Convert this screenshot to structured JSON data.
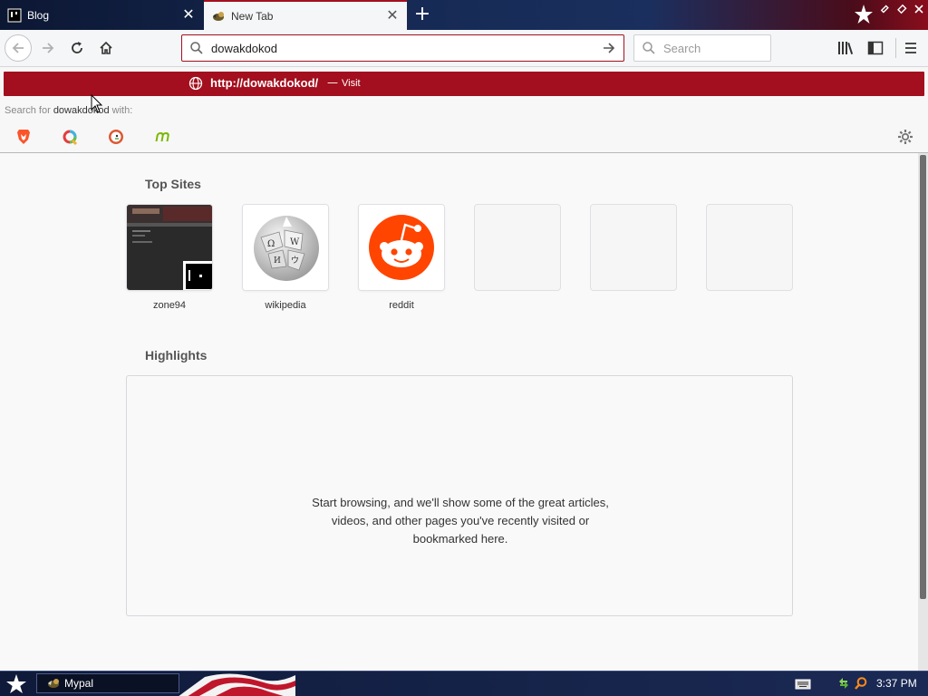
{
  "tabs": [
    {
      "label": "Blog",
      "active": false,
      "icon": "blog-favicon"
    },
    {
      "label": "New Tab",
      "active": true,
      "icon": "mypal-favicon"
    }
  ],
  "urlbar": {
    "value": "dowakdokod",
    "icon": "search-icon"
  },
  "searchbar": {
    "placeholder": "Search"
  },
  "url_popup": {
    "visit_host": "http://dowakdokod/",
    "separator": "—",
    "visit_action": "Visit",
    "search_prefix": "Search for",
    "search_term": "dowakdokod",
    "search_suffix": "with:",
    "engines": [
      "brave-icon",
      "qwant-icon",
      "duckduckgo-icon",
      "mojeek-icon"
    ]
  },
  "content": {
    "top_sites_heading": "Top Sites",
    "top_sites": [
      {
        "label": "zone94"
      },
      {
        "label": "wikipedia"
      },
      {
        "label": "reddit"
      },
      {
        "label": ""
      },
      {
        "label": ""
      },
      {
        "label": ""
      }
    ],
    "highlights_heading": "Highlights",
    "highlights_empty": "Start browsing, and we'll show some of the great articles, videos, and other pages you've recently visited or bookmarked here."
  },
  "taskbar": {
    "task_label": "Mypal",
    "clock": "3:37 PM"
  },
  "colors": {
    "accent": "#a30f1e",
    "tabstrip": "#162a55",
    "reddit": "#ff4500"
  }
}
